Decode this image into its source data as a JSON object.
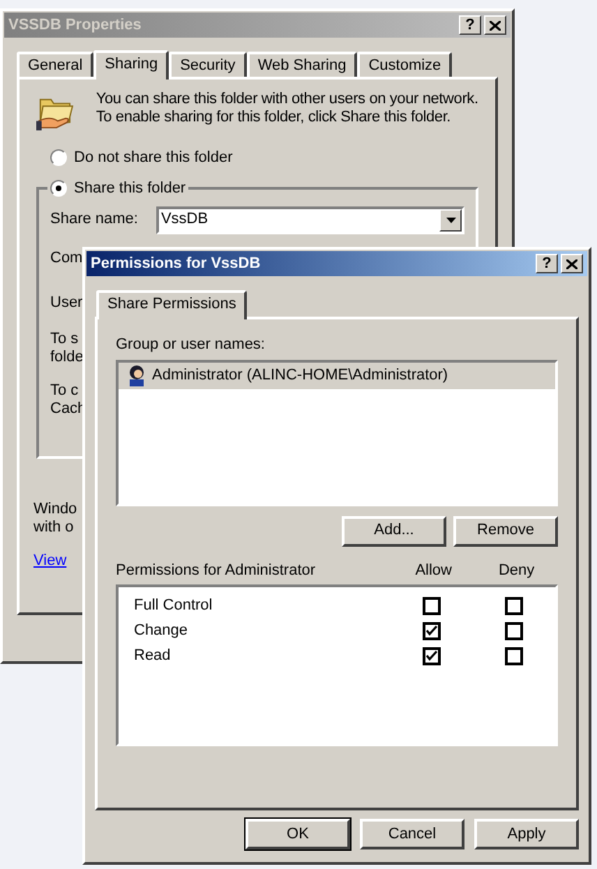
{
  "properties_window": {
    "title": "VSSDB Properties",
    "help": "?",
    "tabs": [
      {
        "label": "General",
        "selected": false
      },
      {
        "label": "Sharing",
        "selected": true
      },
      {
        "label": "Security",
        "selected": false
      },
      {
        "label": "Web Sharing",
        "selected": false
      },
      {
        "label": "Customize",
        "selected": false
      }
    ],
    "intro": "You can share this folder with other users on your network.  To enable sharing for this folder, click Share this folder.",
    "sharing_options": [
      {
        "label": "Do not share this folder",
        "selected": false
      },
      {
        "label": "Share this folder",
        "selected": true
      }
    ],
    "share_name": {
      "label": "Share name:",
      "value": "VssDB"
    },
    "partial_labels": [
      "Com",
      "User"
    ],
    "notes": [
      [
        "To s",
        "folde"
      ],
      [
        "To c",
        "Cach"
      ]
    ],
    "footer": [
      "Windo",
      "with o"
    ],
    "link": "View"
  },
  "permissions_window": {
    "title": "Permissions for VssDB",
    "help": "?",
    "tabs": [
      {
        "label": "Share Permissions",
        "selected": true
      }
    ],
    "group_label": "Group or user names:",
    "users": [
      {
        "name": "Administrator (ALINC-HOME\\Administrator)",
        "selected": true
      }
    ],
    "user_buttons": [
      "Add...",
      "Remove"
    ],
    "permissions_label": "Permissions for Administrator",
    "columns": [
      "Allow",
      "Deny"
    ],
    "permissions": [
      {
        "name": "Full Control",
        "allow": false,
        "deny": false
      },
      {
        "name": "Change",
        "allow": true,
        "deny": false
      },
      {
        "name": "Read",
        "allow": true,
        "deny": false
      }
    ],
    "buttons": [
      "OK",
      "Cancel",
      "Apply"
    ]
  }
}
